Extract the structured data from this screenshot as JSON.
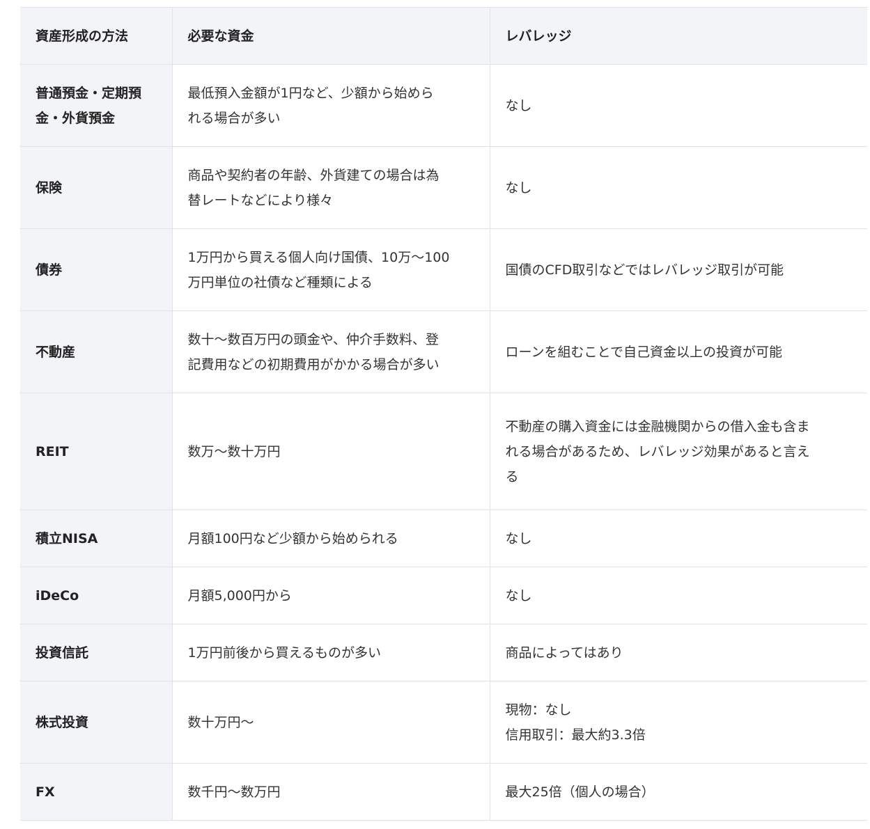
{
  "table": {
    "headers": [
      "資産形成の方法",
      "必要な資金",
      "レバレッジ"
    ],
    "rows": [
      {
        "method": "普通預金・定期預\n金・外貨預金",
        "funds": "最低預入金額が1円など、少額から始めら\nれる場合が多い",
        "leverage": "なし"
      },
      {
        "method": "保険",
        "funds": "商品や契約者の年齢、外貨建ての場合は為\n替レートなどにより様々",
        "leverage": "なし"
      },
      {
        "method": "債券",
        "funds": "1万円から買える個人向け国債、10万～100\n万円単位の社債など種類による",
        "leverage": "国債のCFD取引などではレバレッジ取引が可能"
      },
      {
        "method": "不動産",
        "funds": "数十～数百万円の頭金や、仲介手数料、登\n記費用などの初期費用がかかる場合が多い",
        "leverage": "ローンを組むことで自己資金以上の投資が可能"
      },
      {
        "method": "REIT",
        "funds": "数万～数十万円",
        "leverage": "不動産の購入資金には金融機関からの借入金も含ま\nれる場合があるため、レバレッジ効果があると言え\nる"
      },
      {
        "method": "積立NISA",
        "funds": "月額100円など少額から始められる",
        "leverage": "なし"
      },
      {
        "method": "iDeCo",
        "funds": "月額5,000円から",
        "leverage": "なし"
      },
      {
        "method": "投資信託",
        "funds": "1万円前後から買えるものが多い",
        "leverage": "商品によってはあり"
      },
      {
        "method": "株式投資",
        "funds": "数十万円～",
        "leverage": "現物：なし\n信用取引：最大約3.3倍"
      },
      {
        "method": "FX",
        "funds": "数千円～数万円",
        "leverage": "最大25倍（個人の場合）"
      }
    ]
  }
}
